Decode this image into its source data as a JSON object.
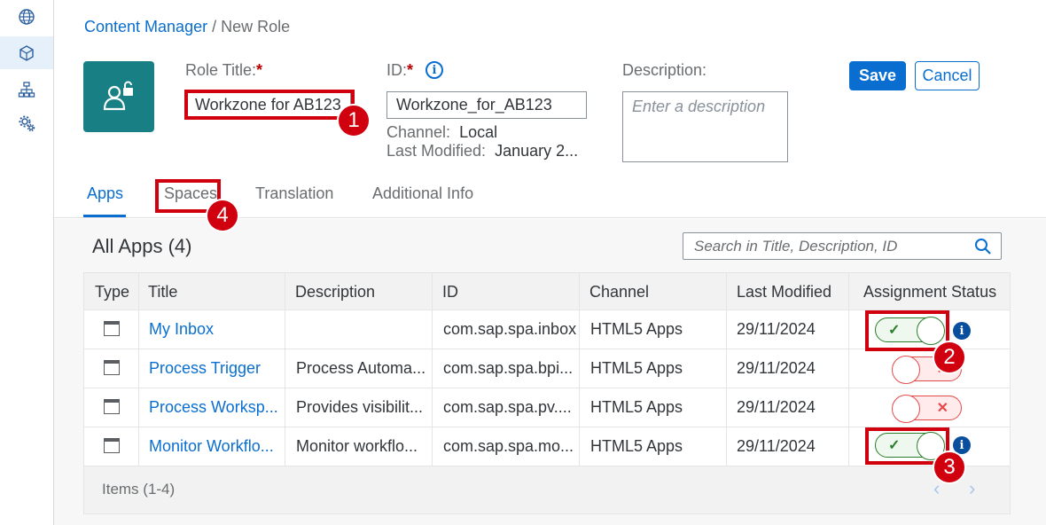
{
  "rail": {
    "items": [
      {
        "icon": "globe-icon"
      },
      {
        "icon": "cube-icon"
      },
      {
        "icon": "hierarchy-icon"
      },
      {
        "icon": "gears-icon"
      }
    ]
  },
  "breadcrumb": {
    "parent": "Content Manager",
    "separator": " / ",
    "current": "New Role"
  },
  "role": {
    "icon": "role-lock-icon",
    "title_label": "Role Title:",
    "title_value": "Workzone for AB123",
    "id_label": "ID:",
    "id_value": "Workzone_for_AB123",
    "required_mark": "*",
    "channel_label": "Channel:",
    "channel_value": "Local",
    "last_modified_label": "Last Modified:",
    "last_modified_value": "January 2...",
    "description_label": "Description:",
    "description_placeholder": "Enter a description"
  },
  "actions": {
    "save": "Save",
    "cancel": "Cancel"
  },
  "tabs": [
    {
      "label": "Apps",
      "active": true
    },
    {
      "label": "Spaces",
      "active": false
    },
    {
      "label": "Translation",
      "active": false
    },
    {
      "label": "Additional Info",
      "active": false
    }
  ],
  "apps": {
    "title": "All Apps (4)",
    "search_placeholder": "Search in Title, Description, ID",
    "columns": [
      "Type",
      "Title",
      "Description",
      "ID",
      "Channel",
      "Last Modified",
      "Assignment Status"
    ],
    "rows": [
      {
        "title": "My Inbox",
        "description": "",
        "id": "com.sap.spa.inbox",
        "channel": "HTML5 Apps",
        "modified": "29/11/2024",
        "assigned": true
      },
      {
        "title": "Process Trigger",
        "description": "Process Automa...",
        "id": "com.sap.spa.bpi...",
        "channel": "HTML5 Apps",
        "modified": "29/11/2024",
        "assigned": false
      },
      {
        "title": "Process Worksp...",
        "description": "Provides visibilit...",
        "id": "com.sap.spa.pv....",
        "channel": "HTML5 Apps",
        "modified": "29/11/2024",
        "assigned": false
      },
      {
        "title": "Monitor Workflo...",
        "description": "Monitor workflo...",
        "id": "com.sap.spa.mo...",
        "channel": "HTML5 Apps",
        "modified": "29/11/2024",
        "assigned": true
      }
    ],
    "footer": "Items (1-4)"
  },
  "callouts": [
    "1",
    "2",
    "3",
    "4"
  ],
  "colors": {
    "accent": "#0a6ed1",
    "callout": "#d0000f",
    "toggle_on": "#2b7d2b",
    "toggle_off": "#e34b4b",
    "avatar": "#188085"
  }
}
